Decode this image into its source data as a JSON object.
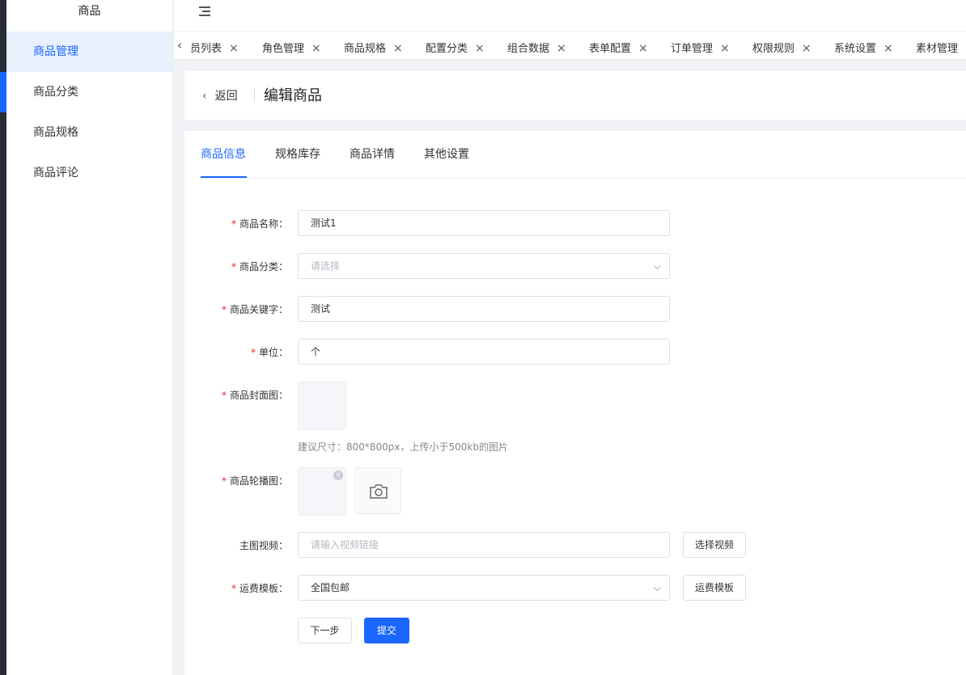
{
  "sidebar": {
    "title": "商品",
    "items": [
      {
        "label": "商品管理"
      },
      {
        "label": "商品分类"
      },
      {
        "label": "商品规格"
      },
      {
        "label": "商品评论"
      }
    ]
  },
  "tabs": {
    "prev_icon": "chevron-left-icon",
    "items": [
      {
        "label": "员列表"
      },
      {
        "label": "角色管理"
      },
      {
        "label": "商品规格"
      },
      {
        "label": "配置分类"
      },
      {
        "label": "组合数据"
      },
      {
        "label": "表单配置"
      },
      {
        "label": "订单管理"
      },
      {
        "label": "权限规则"
      },
      {
        "label": "系统设置"
      },
      {
        "label": "素材管理"
      }
    ],
    "close_glyph": "×"
  },
  "header": {
    "back_label": "返回",
    "title": "编辑商品"
  },
  "form_tabs": [
    {
      "label": "商品信息"
    },
    {
      "label": "规格库存"
    },
    {
      "label": "商品详情"
    },
    {
      "label": "其他设置"
    }
  ],
  "form": {
    "required_mark": "*",
    "name": {
      "label": "商品名称：",
      "value": "测试1"
    },
    "category": {
      "label": "商品分类：",
      "placeholder": "请选择"
    },
    "keywords": {
      "label": "商品关键字：",
      "value": "测试"
    },
    "unit": {
      "label": "单位：",
      "value": "个"
    },
    "cover": {
      "label": "商品封面图：",
      "tip": "建议尺寸：800*800px，上传小于500kb的图片"
    },
    "carousel": {
      "label": "商品轮播图："
    },
    "video": {
      "label": "主图视频：",
      "placeholder": "请输入视频链接",
      "button": "选择视频"
    },
    "shipping": {
      "label": "运费模板：",
      "value": "全国包邮",
      "button": "运费模板"
    },
    "next_button": "下一步",
    "submit_button": "提交"
  },
  "colors": {
    "accent": "#1a66ff",
    "required": "#f5222d",
    "sidebar_dark": "#282c34"
  }
}
